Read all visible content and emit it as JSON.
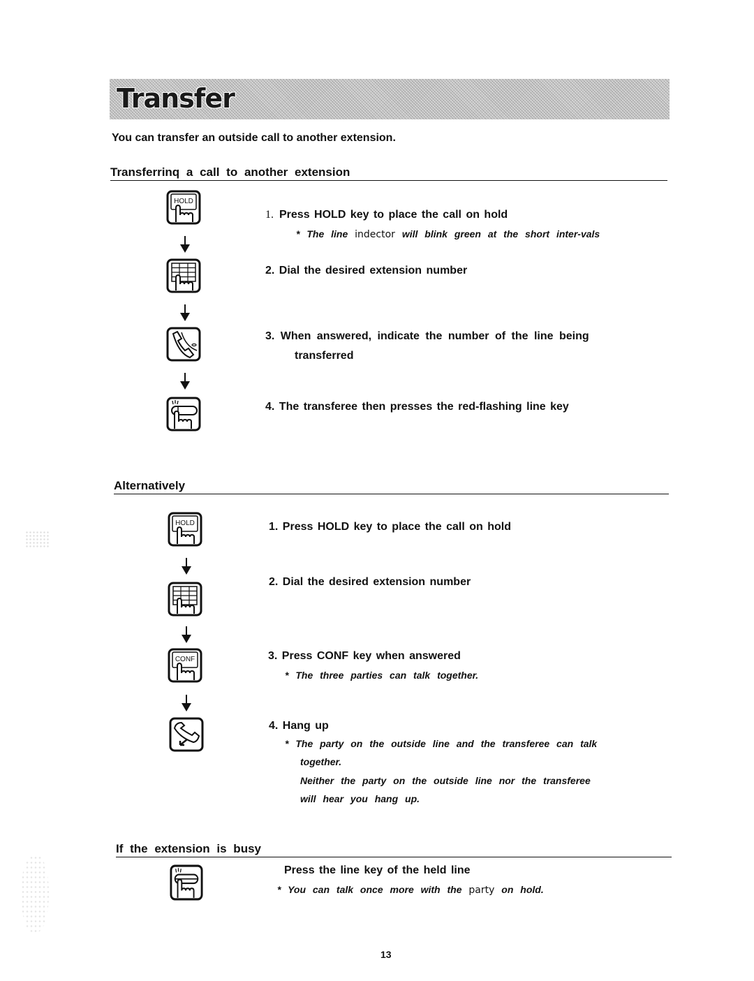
{
  "title": "Transfer",
  "intro": "You can transfer an outside call to another extension.",
  "sections": [
    {
      "heading": "Transferrinq a call to another extension",
      "steps": [
        {
          "number": "1.",
          "text": "Press HOLD key to place the call on hold",
          "icon": "hold-key-icon",
          "icon_label": "HOLD",
          "note": {
            "prefix": "*",
            "pre": "The line",
            "mid": "indector",
            "post": "will blink green at the short inter-vals"
          }
        },
        {
          "number": "2.",
          "text": "Dial the desired extension number",
          "icon": "dial-keypad-icon"
        },
        {
          "number": "3.",
          "text": "When answered, indicate the number of the line being",
          "text_cont": "transferred",
          "icon": "handset-talk-icon"
        },
        {
          "number": "4.",
          "text": "The transferee then presses the red-flashing line key",
          "icon": "line-key-flashing-icon"
        }
      ]
    },
    {
      "heading": "Alternatively",
      "steps": [
        {
          "number": "1.",
          "text": "Press HOLD key to place the call on hold",
          "icon": "hold-key-icon",
          "icon_label": "HOLD"
        },
        {
          "number": "2.",
          "text": "Dial the desired extension number",
          "icon": "dial-keypad-icon"
        },
        {
          "number": "3.",
          "text": "Press CONF key when answered",
          "icon": "conf-key-icon",
          "icon_label": "CONF",
          "note": "* The three parties can talk together."
        },
        {
          "number": "4.",
          "text": "Hang up",
          "icon": "hang-up-icon",
          "note_lines": [
            "* The party on the outside line and the transferee can talk",
            "together.",
            "Neither the party on the outside line nor the transferee",
            "will hear you hang up."
          ]
        }
      ]
    },
    {
      "heading": "If the extension is busy",
      "steps": [
        {
          "text": "Press the line key of the held line",
          "icon": "line-key-flashing-icon",
          "note": {
            "pre": "* You can talk once more with the",
            "mid": "party",
            "post": "on hold."
          }
        }
      ]
    }
  ],
  "page_number": "13"
}
